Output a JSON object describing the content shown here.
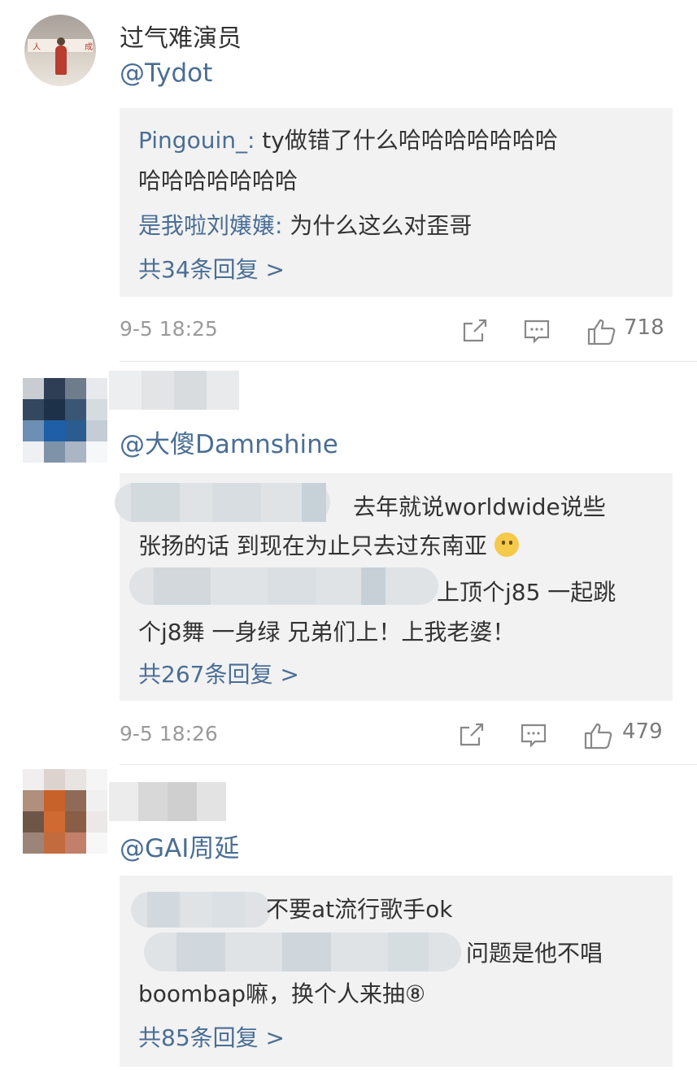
{
  "comments": [
    {
      "name": "过气难演员",
      "mention": "@Tydot",
      "lines": [
        {
          "user": "Pingouin_:",
          "text": " ty做错了什么哈哈哈哈哈哈哈"
        },
        {
          "user": "",
          "text": "哈哈哈哈哈哈哈"
        },
        {
          "user": "是我啦刘嬢嬢:",
          "text": " 为什么这么对歪哥"
        }
      ],
      "more": "共34条回复 >",
      "time": "9-5 18:25",
      "likes": "718"
    },
    {
      "name": "",
      "mention": "@大傻Damnshine",
      "lines": [
        {
          "user": "",
          "text": "去年就说worldwide说些"
        },
        {
          "user": "",
          "text": "张扬的话 到现在为止只去过东南亚"
        },
        {
          "user": "",
          "text": "上顶个j85 一起跳"
        },
        {
          "user": "",
          "text": "个j8舞 一身绿 兄弟们上！上我老婆！"
        }
      ],
      "more": "共267条回复 >",
      "time": "9-5 18:26",
      "likes": "479"
    },
    {
      "name": "",
      "mention": "@GAI周延",
      "lines": [
        {
          "user": "",
          "text": "不要at流行歌手ok"
        },
        {
          "user": "",
          "text": "问题是他不唱"
        },
        {
          "user": "",
          "text": "boombap嘛，换个人来抽⑧"
        }
      ],
      "more": "共85条回复 >"
    }
  ],
  "icons": {
    "share": "share-icon",
    "comment": "comment-icon",
    "like": "thumbs-up-icon"
  },
  "colors": {
    "link": "#4a6e95",
    "reply_bg": "#f2f2f2",
    "meta": "#9a9a9a"
  }
}
